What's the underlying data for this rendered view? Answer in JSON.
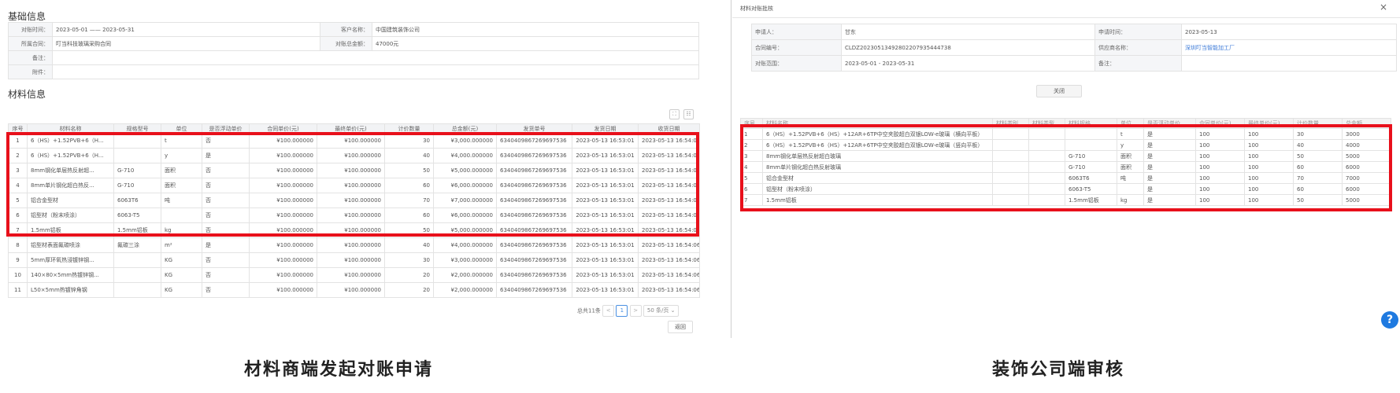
{
  "left": {
    "basic_title": "基础信息",
    "info": [
      {
        "k1": "对账时间：",
        "v1": "2023-05-01 —— 2023-05-31",
        "k2": "客户名称：",
        "v2": "中国建筑装饰公司"
      },
      {
        "k1": "所属合同：",
        "v1": "叮当科技玻璃采购合同",
        "k2": "对账总金额：",
        "v2": "47000元"
      }
    ],
    "remark_label": "备注：",
    "attach_label": "附件：",
    "material_title": "材料信息",
    "headers": [
      "序号",
      "材料名称",
      "规格型号",
      "单位",
      "是否浮动单价",
      "合同单价(元)",
      "最终单价(元)",
      "计价数量",
      "总金额(元)",
      "发货单号",
      "发货日期",
      "收货日期"
    ],
    "rows": [
      [
        "1",
        "6（HS）+1.52PVB+6（H...",
        "",
        "t",
        "否",
        "¥100.000000",
        "¥100.000000",
        "30",
        "¥3,000.000000",
        "634040986726969753​6",
        "2023-05-13 16:53:01",
        "2023-05-13 16:54:06"
      ],
      [
        "2",
        "6（HS）+1.52PVB+6（H...",
        "",
        "y",
        "是",
        "¥100.000000",
        "¥100.000000",
        "40",
        "¥4,000.000000",
        "6340409867269697536",
        "2023-05-13 16:53:01",
        "2023-05-13 16:54:06"
      ],
      [
        "3",
        "8mm钢化单层热反射超...",
        "G-710",
        "面积",
        "否",
        "¥100.000000",
        "¥100.000000",
        "50",
        "¥5,000.000000",
        "6340409867269697536",
        "2023-05-13 16:53:01",
        "2023-05-13 16:54:06"
      ],
      [
        "4",
        "8mm单片钢化超白热反...",
        "G-710",
        "面积",
        "否",
        "¥100.000000",
        "¥100.000000",
        "60",
        "¥6,000.000000",
        "6340409867269697536",
        "2023-05-13 16:53:01",
        "2023-05-13 16:54:06"
      ],
      [
        "5",
        "铝合金型材",
        "6063T6",
        "吨",
        "否",
        "¥100.000000",
        "¥100.000000",
        "70",
        "¥7,000.000000",
        "6340409867269697536",
        "2023-05-13 16:53:01",
        "2023-05-13 16:54:06"
      ],
      [
        "6",
        "铝型材（粉末喷涂）",
        "6063-T5",
        "",
        "否",
        "¥100.000000",
        "¥100.000000",
        "60",
        "¥6,000.000000",
        "6340409867269697536",
        "2023-05-13 16:53:01",
        "2023-05-13 16:54:06"
      ],
      [
        "7",
        "1.5mm铝板",
        "1.5mm铝板",
        "kg",
        "否",
        "¥100.000000",
        "¥100.000000",
        "50",
        "¥5,000.000000",
        "6340409867269697536",
        "2023-05-13 16:53:01",
        "2023-05-13 16:54:06"
      ],
      [
        "8",
        "铝型材表面氟碳喷涂",
        "氟碳三涂",
        "m²",
        "是",
        "¥100.000000",
        "¥100.000000",
        "40",
        "¥4,000.000000",
        "6340409867269697536",
        "2023-05-13 16:53:01",
        "2023-05-13 16:54:06"
      ],
      [
        "9",
        "5mm厚环氧热浸镀锌钢...",
        "",
        "KG",
        "否",
        "¥100.000000",
        "¥100.000000",
        "30",
        "¥3,000.000000",
        "6340409867269697536",
        "2023-05-13 16:53:01",
        "2023-05-13 16:54:06"
      ],
      [
        "10",
        "140×80×5mm热镀锌钢...",
        "",
        "KG",
        "否",
        "¥100.000000",
        "¥100.000000",
        "20",
        "¥2,000.000000",
        "6340409867269697536",
        "2023-05-13 16:53:01",
        "2023-05-13 16:54:06"
      ],
      [
        "11",
        "L50×5mm热镀锌角钢",
        "",
        "KG",
        "否",
        "¥100.000000",
        "¥100.000000",
        "20",
        "¥2,000.000000",
        "6340409867269697536",
        "2023-05-13 16:53:01",
        "2023-05-13 16:54:06"
      ]
    ],
    "pager": {
      "total": "总共11条",
      "prev": "<",
      "page": "1",
      "next": ">",
      "size": "50 条/页"
    },
    "back_button": "返回"
  },
  "right": {
    "dialog_title": "材料对账批核",
    "close": "×",
    "info": [
      {
        "k1": "申请人：",
        "v1": "甘东",
        "k2": "申请时间：",
        "v2": "2023-05-13"
      },
      {
        "k1": "合同编号：",
        "v1": "CLDZ20230513492802207935444738",
        "k2": "供应商名称：",
        "v2": "深圳叮当智能加工厂"
      },
      {
        "k1": "对账范围：",
        "v1": "2023-05-01 - 2023-05-31",
        "k2": "备注：",
        "v2": ""
      }
    ],
    "close_button": "关闭",
    "headers": [
      "序号",
      "材料名称",
      "材料类别",
      "材料类型",
      "材料规格",
      "单位",
      "是否浮动单价",
      "合同单价(元)",
      "最终单价(元)",
      "计价数量",
      "总金额"
    ],
    "rows": [
      [
        "1",
        "6（HS）+1.52PVB+6（HS）+12AR+6TP中空夹胶超白双银LOW-e玻璃（横向平板）",
        "",
        "",
        "",
        "t",
        "是",
        "100",
        "100",
        "30",
        "3000"
      ],
      [
        "2",
        "6（HS）+1.52PVB+6（HS）+12AR+6TP中空夹胶超白双银LOW-e玻璃（竖向平板）",
        "",
        "",
        "",
        "y",
        "是",
        "100",
        "100",
        "40",
        "4000"
      ],
      [
        "3",
        "8mm钢化单层热反射超白玻璃",
        "",
        "",
        "G-710",
        "面积",
        "是",
        "100",
        "100",
        "50",
        "5000"
      ],
      [
        "4",
        "8mm单片钢化超白热反射玻璃",
        "",
        "",
        "G-710",
        "面积",
        "是",
        "100",
        "100",
        "60",
        "6000"
      ],
      [
        "5",
        "铝合金型材",
        "",
        "",
        "6063T6",
        "吨",
        "是",
        "100",
        "100",
        "70",
        "7000"
      ],
      [
        "6",
        "铝型材（粉末喷涂）",
        "",
        "",
        "6063-T5",
        "",
        "是",
        "100",
        "100",
        "60",
        "6000"
      ],
      [
        "7",
        "1.5mm铝板",
        "",
        "",
        "1.5mm铝板",
        "kg",
        "是",
        "100",
        "100",
        "50",
        "5000"
      ]
    ],
    "help": "?"
  },
  "captions": {
    "left": "材料商端发起对账申请",
    "right": "装饰公司端审核"
  },
  "colors": {
    "highlight": "#e8101b",
    "accent": "#4a90e2"
  }
}
